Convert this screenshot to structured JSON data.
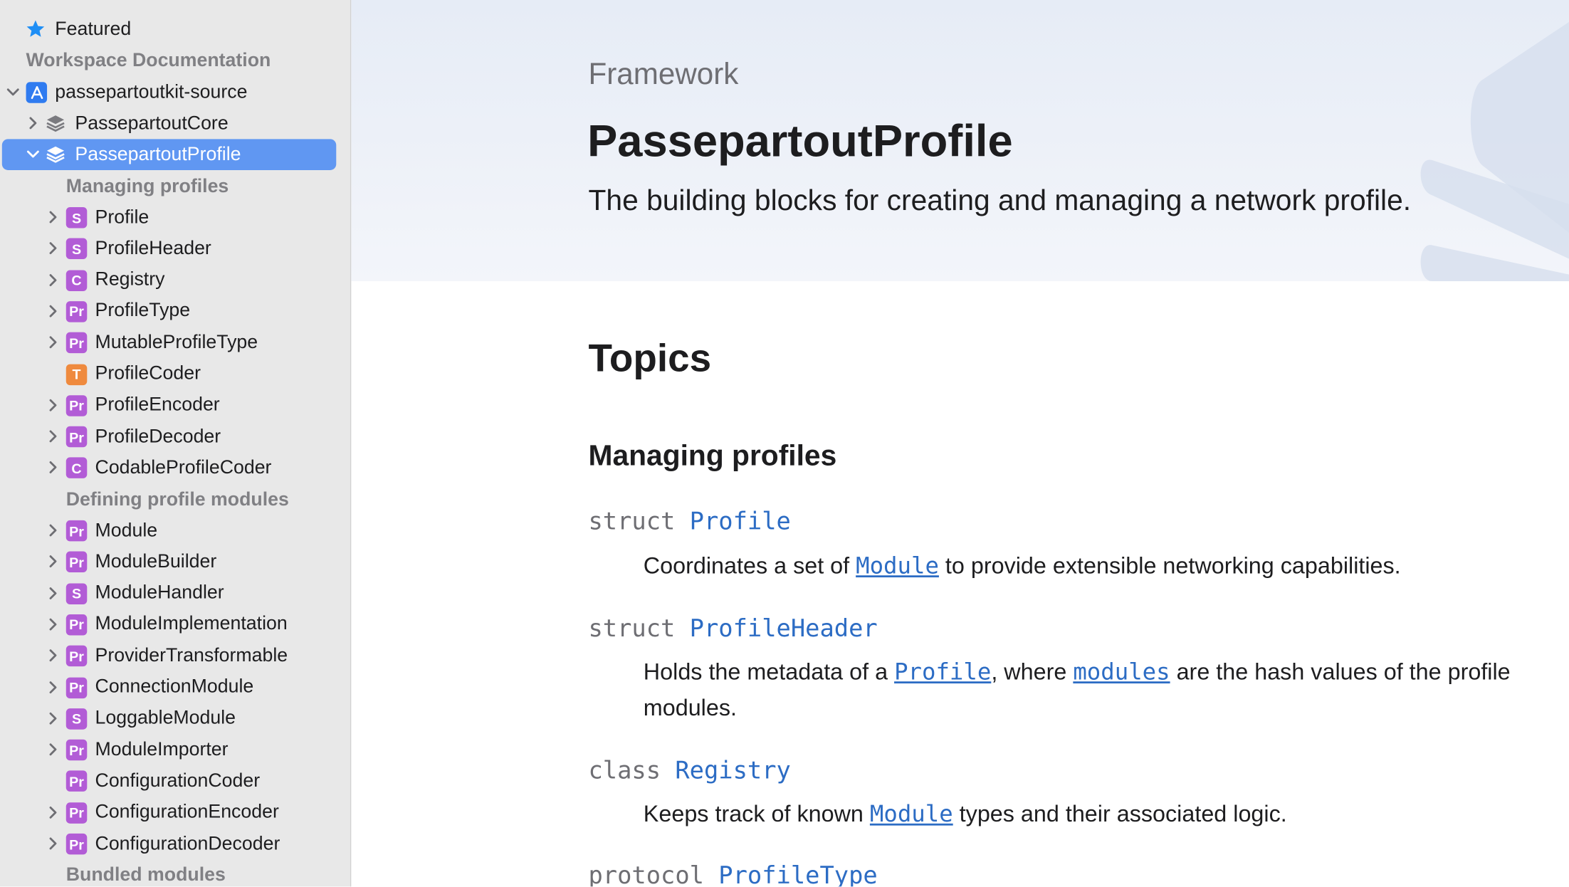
{
  "sidebar": {
    "featured_label": "Featured",
    "workspace_header": "Workspace Documentation",
    "source_label": "passepartoutkit-source",
    "core_label": "PassepartoutCore",
    "profile_label": "PassepartoutProfile",
    "sections": [
      "Managing profiles",
      "Defining profile modules",
      "Bundled modules"
    ],
    "items": [
      {
        "badge": "S",
        "label": "Profile"
      },
      {
        "badge": "S",
        "label": "ProfileHeader"
      },
      {
        "badge": "C",
        "label": "Registry"
      },
      {
        "badge": "Pr",
        "label": "ProfileType"
      },
      {
        "badge": "Pr",
        "label": "MutableProfileType"
      },
      {
        "badge": "T",
        "label": "ProfileCoder"
      },
      {
        "badge": "Pr",
        "label": "ProfileEncoder"
      },
      {
        "badge": "Pr",
        "label": "ProfileDecoder"
      },
      {
        "badge": "C",
        "label": "CodableProfileCoder"
      },
      {
        "badge": "Pr",
        "label": "Module"
      },
      {
        "badge": "Pr",
        "label": "ModuleBuilder"
      },
      {
        "badge": "S",
        "label": "ModuleHandler"
      },
      {
        "badge": "Pr",
        "label": "ModuleImplementation"
      },
      {
        "badge": "Pr",
        "label": "ProviderTransformable"
      },
      {
        "badge": "Pr",
        "label": "ConnectionModule"
      },
      {
        "badge": "S",
        "label": "LoggableModule"
      },
      {
        "badge": "Pr",
        "label": "ModuleImporter"
      },
      {
        "badge": "Pr",
        "label": "ConfigurationCoder"
      },
      {
        "badge": "Pr",
        "label": "ConfigurationEncoder"
      },
      {
        "badge": "Pr",
        "label": "ConfigurationDecoder"
      }
    ]
  },
  "colors": {
    "badge_struct": "#b25cd6",
    "badge_class": "#b25cd6",
    "badge_protocol": "#b25cd6",
    "badge_typealias": "#ef8a3e",
    "selection": "#6097f2",
    "link": "#2c6cc4"
  },
  "main": {
    "eyebrow": "Framework",
    "title": "PassepartoutProfile",
    "abstract": "The building blocks for creating and managing a network profile.",
    "topics_heading": "Topics",
    "group_heading": "Managing profiles",
    "topics": [
      {
        "kw": "struct",
        "name": "Profile",
        "desc": {
          "pre": "Coordinates a set of ",
          "code": "Module",
          "post": " to provide extensible networking capabilities."
        }
      },
      {
        "kw": "struct",
        "name": "ProfileHeader",
        "desc": {
          "pre": "Holds the metadata of a ",
          "code": "Profile",
          "mid": ", where ",
          "code2": "modules",
          "post": " are the hash values of the profile modules."
        }
      },
      {
        "kw": "class",
        "name": "Registry",
        "desc": {
          "pre": "Keeps track of known ",
          "code": "Module",
          "post": " types and their associated logic."
        }
      },
      {
        "kw": "protocol",
        "name": "ProfileType"
      }
    ]
  }
}
